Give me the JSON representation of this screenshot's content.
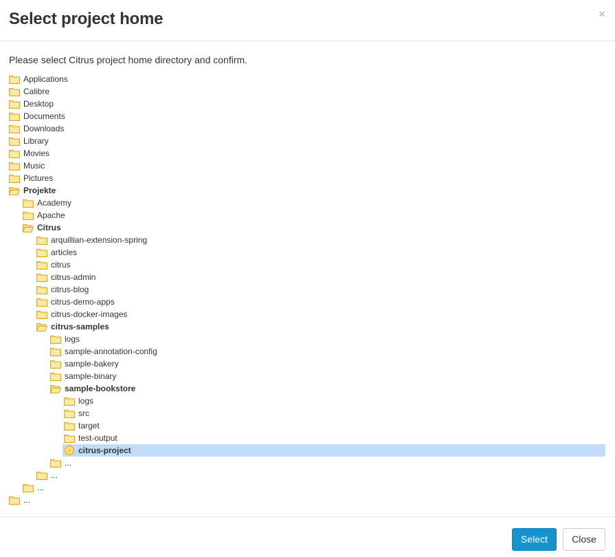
{
  "dialog": {
    "title": "Select project home",
    "close_glyph": "×",
    "instruction": "Please select Citrus project home directory and confirm."
  },
  "tree": [
    {
      "label": "Applications",
      "depth": 0,
      "state": "closed"
    },
    {
      "label": "Calibre",
      "depth": 0,
      "state": "closed"
    },
    {
      "label": "Desktop",
      "depth": 0,
      "state": "closed"
    },
    {
      "label": "Documents",
      "depth": 0,
      "state": "closed"
    },
    {
      "label": "Downloads",
      "depth": 0,
      "state": "closed"
    },
    {
      "label": "Library",
      "depth": 0,
      "state": "closed"
    },
    {
      "label": "Movies",
      "depth": 0,
      "state": "closed"
    },
    {
      "label": "Music",
      "depth": 0,
      "state": "closed"
    },
    {
      "label": "Pictures",
      "depth": 0,
      "state": "closed"
    },
    {
      "label": "Projekte",
      "depth": 0,
      "state": "open"
    },
    {
      "label": "Academy",
      "depth": 1,
      "state": "closed"
    },
    {
      "label": "Apache",
      "depth": 1,
      "state": "closed"
    },
    {
      "label": "Citrus",
      "depth": 1,
      "state": "open"
    },
    {
      "label": "arquillian-extension-spring",
      "depth": 2,
      "state": "closed"
    },
    {
      "label": "articles",
      "depth": 2,
      "state": "closed"
    },
    {
      "label": "citrus",
      "depth": 2,
      "state": "closed"
    },
    {
      "label": "citrus-admin",
      "depth": 2,
      "state": "closed"
    },
    {
      "label": "citrus-blog",
      "depth": 2,
      "state": "closed"
    },
    {
      "label": "citrus-demo-apps",
      "depth": 2,
      "state": "closed"
    },
    {
      "label": "citrus-docker-images",
      "depth": 2,
      "state": "closed"
    },
    {
      "label": "citrus-samples",
      "depth": 2,
      "state": "open"
    },
    {
      "label": "logs",
      "depth": 3,
      "state": "closed"
    },
    {
      "label": "sample-annotation-config",
      "depth": 3,
      "state": "closed"
    },
    {
      "label": "sample-bakery",
      "depth": 3,
      "state": "closed"
    },
    {
      "label": "sample-binary",
      "depth": 3,
      "state": "closed"
    },
    {
      "label": "sample-bookstore",
      "depth": 3,
      "state": "open"
    },
    {
      "label": "logs",
      "depth": 4,
      "state": "closed"
    },
    {
      "label": "src",
      "depth": 4,
      "state": "closed"
    },
    {
      "label": "target",
      "depth": 4,
      "state": "closed"
    },
    {
      "label": "test-output",
      "depth": 4,
      "state": "closed"
    },
    {
      "label": "citrus-project",
      "depth": 4,
      "state": "project",
      "selected": true
    },
    {
      "label": "...",
      "depth": 3,
      "state": "closed"
    },
    {
      "label": "...",
      "depth": 2,
      "state": "closed"
    },
    {
      "label": "...",
      "depth": 1,
      "state": "closed"
    },
    {
      "label": "...",
      "depth": 0,
      "state": "closed"
    }
  ],
  "footer": {
    "select_label": "Select",
    "close_label": "Close"
  },
  "colors": {
    "primary": "#1493cf",
    "selected_row": "#c1ddfb",
    "folder_fill": "#fbd775",
    "folder_stroke": "#d8a928",
    "project_icon": "#f7b731"
  }
}
